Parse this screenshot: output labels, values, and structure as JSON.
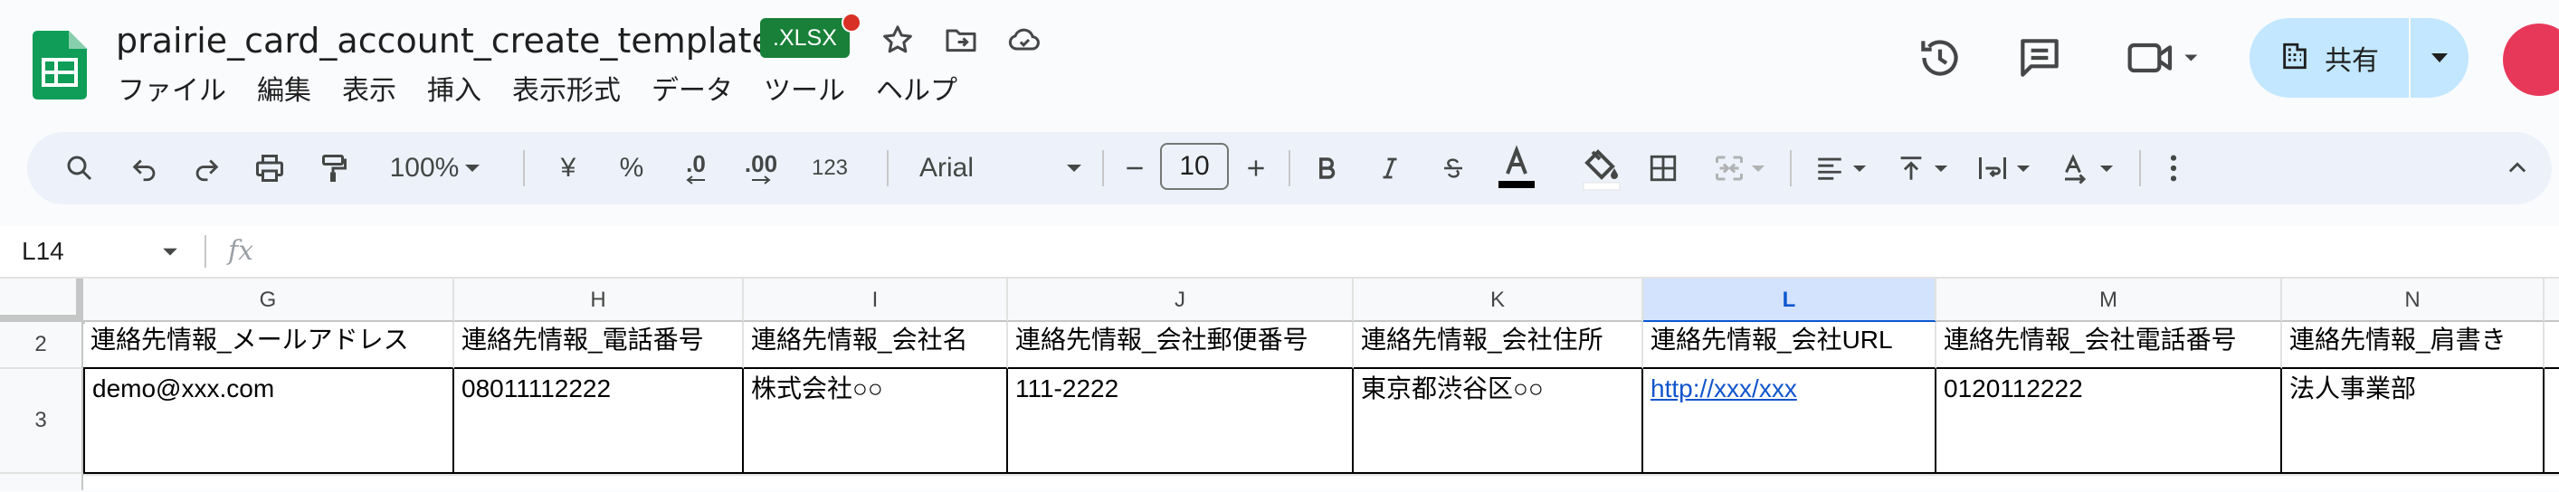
{
  "app": {
    "doc_title": "prairie_card_account_create_template",
    "format_badge": ".XLSX"
  },
  "menu": [
    "ファイル",
    "編集",
    "表示",
    "挿入",
    "表示形式",
    "データ",
    "ツール",
    "ヘルプ"
  ],
  "share": {
    "label": "共有"
  },
  "toolbar": {
    "zoom": "100%",
    "currency": "¥",
    "percent": "%",
    "decrease_decimal": ".0",
    "increase_decimal": ".00",
    "number_format": "123",
    "font": "Arial",
    "font_size": "10"
  },
  "formula_bar": {
    "cell_ref": "L14",
    "fx": "fx"
  },
  "sheet": {
    "columns": [
      "G",
      "H",
      "I",
      "J",
      "K",
      "L",
      "M",
      "N"
    ],
    "selected_column": "L",
    "rows": [
      {
        "num": "2",
        "cells": [
          "連絡先情報_メールアドレス",
          "連絡先情報_電話番号",
          "連絡先情報_会社名",
          "連絡先情報_会社郵便番号",
          "連絡先情報_会社住所",
          "連絡先情報_会社URL",
          "連絡先情報_会社電話番号",
          "連絡先情報_肩書き"
        ]
      },
      {
        "num": "3",
        "cells": [
          "demo@xxx.com",
          "08011112222",
          "株式会社○○",
          "111-2222",
          "東京都渋谷区○○",
          "http://xxx/xxx",
          "0120112222",
          "法人事業部"
        ]
      }
    ]
  },
  "colors": {
    "accent": "#0b57d0",
    "share_bg": "#c2e7ff",
    "badge_bg": "#188038",
    "link": "#1155cc"
  }
}
